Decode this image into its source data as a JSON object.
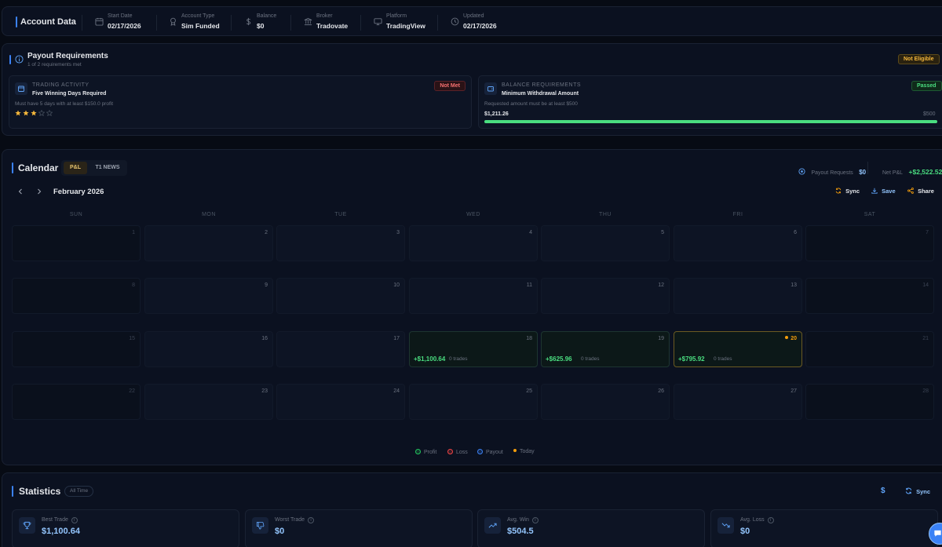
{
  "account": {
    "title": "Account Data",
    "items": [
      {
        "label": "Start Date",
        "value": "02/17/2026",
        "icon": "calendar-icon"
      },
      {
        "label": "Account Type",
        "value": "Sim Funded",
        "icon": "badge-icon"
      },
      {
        "label": "Balance",
        "value": "$0",
        "icon": "dollar-icon"
      },
      {
        "label": "Broker",
        "value": "Tradovate",
        "icon": "bank-icon"
      },
      {
        "label": "Platform",
        "value": "TradingView",
        "icon": "monitor-icon"
      },
      {
        "label": "Updated",
        "value": "02/17/2026",
        "icon": "clock-icon"
      }
    ]
  },
  "payout": {
    "title": "Payout Requirements",
    "subtitle": "1 of 2 requirements met",
    "status": "Not Eligible",
    "requirements": [
      {
        "category": "TRADING ACTIVITY",
        "name": "Five Winning Days Required",
        "description": "Must have 5 days with at least $150.0 profit",
        "status": "Not Met",
        "stars_filled": 3,
        "stars_total": 5,
        "icon": "calendar-icon"
      },
      {
        "category": "BALANCE REQUIREMENTS",
        "name": "Minimum Withdrawal Amount",
        "description": "Requested amount must be at least $500",
        "status": "Passed",
        "current": "$1,211.26",
        "target": "$500",
        "progress": 1.0,
        "icon": "wallet-icon"
      }
    ]
  },
  "calendar": {
    "title": "Calendar",
    "tabs": [
      {
        "label": "P&L",
        "active": true
      },
      {
        "label": "T1 NEWS",
        "active": false
      }
    ],
    "payout_requests_label": "Payout Requests",
    "payout_requests_value": "$0",
    "net_pnl_label": "Net P&L",
    "net_pnl_value": "+$2,522.52",
    "month": "February 2026",
    "actions": {
      "sync": "Sync",
      "save": "Save",
      "share": "Share"
    },
    "weekdays": [
      "SUN",
      "MON",
      "TUE",
      "WED",
      "THU",
      "FRI",
      "SAT"
    ],
    "weeks": [
      [
        {
          "day": "1"
        },
        {
          "day": "2"
        },
        {
          "day": "3"
        },
        {
          "day": "4"
        },
        {
          "day": "5"
        },
        {
          "day": "6"
        },
        {
          "day": "7"
        }
      ],
      [
        {
          "day": "8"
        },
        {
          "day": "9"
        },
        {
          "day": "10"
        },
        {
          "day": "11"
        },
        {
          "day": "12"
        },
        {
          "day": "13"
        },
        {
          "day": "14"
        }
      ],
      [
        {
          "day": "15"
        },
        {
          "day": "16"
        },
        {
          "day": "17"
        },
        {
          "day": "18",
          "pnl": "+$1,100.64",
          "trades": "0 trades"
        },
        {
          "day": "19",
          "pnl": "+$625.96",
          "trades": "0 trades"
        },
        {
          "day": "20",
          "pnl": "+$795.92",
          "trades": "0 trades",
          "today": true
        },
        {
          "day": "21"
        }
      ],
      [
        {
          "day": "22"
        },
        {
          "day": "23"
        },
        {
          "day": "24"
        },
        {
          "day": "25"
        },
        {
          "day": "26"
        },
        {
          "day": "27"
        },
        {
          "day": "28"
        }
      ]
    ],
    "legend": [
      {
        "label": "Profit",
        "color": "#22c55e"
      },
      {
        "label": "Loss",
        "color": "#ef4444"
      },
      {
        "label": "Payout",
        "color": "#3b82f6"
      },
      {
        "label": "Today",
        "color": "#f59e0b"
      }
    ]
  },
  "statistics": {
    "title": "Statistics",
    "filter": "All Time",
    "currency_symbol": "$",
    "sync_label": "Sync",
    "cards": [
      {
        "label": "Best Trade",
        "value": "$1,100.64",
        "icon": "trophy-icon"
      },
      {
        "label": "Worst Trade",
        "value": "$0",
        "icon": "thumbs-down-icon"
      },
      {
        "label": "Avg. Win",
        "value": "$504.5",
        "icon": "trending-up-icon"
      },
      {
        "label": "Avg. Loss",
        "value": "$0",
        "icon": "trending-down-icon"
      }
    ]
  },
  "colors": {
    "accent": "#3b82f6",
    "profit": "#4ade80",
    "warning": "#f59e0b",
    "danger": "#f87171"
  }
}
